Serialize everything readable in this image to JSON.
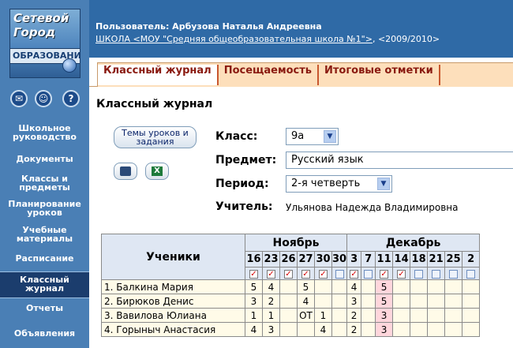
{
  "logo": {
    "line1": "Сетевой",
    "line2": "Город",
    "line3": "ОБРАЗОВАНИ"
  },
  "sidebar": {
    "icons": [
      {
        "name": "mail-icon",
        "glyph": "✉"
      },
      {
        "name": "users-icon",
        "glyph": "☺"
      },
      {
        "name": "help-icon",
        "glyph": "?"
      }
    ],
    "items": [
      {
        "label": "Школьное руководство"
      },
      {
        "label": "Документы"
      },
      {
        "label": "Классы и предметы"
      },
      {
        "label": "Планирование уроков"
      },
      {
        "label": "Учебные материалы"
      },
      {
        "label": "Расписание"
      },
      {
        "label": "Классный журнал",
        "active": true
      },
      {
        "label": "Отчеты"
      },
      {
        "label": "Объявления"
      }
    ]
  },
  "header": {
    "user": "Пользователь: Арбузова Наталья Андреевна",
    "school_link": "ШКОЛА <МОУ \"Средняя общеобразовательная школа №1\">",
    "year": ", <2009/2010>"
  },
  "tabs": [
    {
      "label": "Классный журнал",
      "active": true
    },
    {
      "label": "Посещаемость"
    },
    {
      "label": "Итоговые отметки"
    }
  ],
  "page_title": "Классный журнал",
  "form": {
    "topics_button": "Темы уроков и задания",
    "class_label": "Класс:",
    "class_value": "9а",
    "subject_label": "Предмет:",
    "subject_value": "Русский язык",
    "period_label": "Период:",
    "period_value": "2-я четверть",
    "teacher_label": "Учитель:",
    "teacher_value": "Ульянова Надежда Владимировна"
  },
  "journal": {
    "students_header": "Ученики",
    "months": [
      {
        "name": "Ноябрь",
        "days": [
          "16",
          "23",
          "26",
          "27",
          "30",
          "30"
        ],
        "checked": [
          true,
          true,
          true,
          true,
          true,
          false
        ]
      },
      {
        "name": "Декабрь",
        "days": [
          "3",
          "7",
          "11",
          "14",
          "18",
          "21",
          "25",
          "2"
        ],
        "checked": [
          true,
          false,
          true,
          true,
          false,
          false,
          false,
          false
        ]
      }
    ],
    "rows": [
      {
        "name": "1. Балкина Мария",
        "grades": [
          "5",
          "4",
          "",
          "5",
          "",
          "",
          "4",
          "",
          "5",
          "",
          "",
          "",
          "",
          ""
        ]
      },
      {
        "name": "2. Бирюков Денис",
        "grades": [
          "3",
          "2",
          "",
          "4",
          "",
          "",
          "3",
          "",
          "5",
          "",
          "",
          "",
          "",
          ""
        ]
      },
      {
        "name": "3. Вавилова Юлиана",
        "grades": [
          "1",
          "1",
          "",
          "ОТ",
          "1",
          "",
          "2",
          "",
          "3",
          "",
          "",
          "",
          "",
          ""
        ]
      },
      {
        "name": "4. Горыныч Анастасия",
        "grades": [
          "4",
          "3",
          "",
          "",
          "4",
          "",
          "2",
          "",
          "3",
          "",
          "",
          "",
          "",
          ""
        ]
      }
    ],
    "highlight_column": 8
  }
}
